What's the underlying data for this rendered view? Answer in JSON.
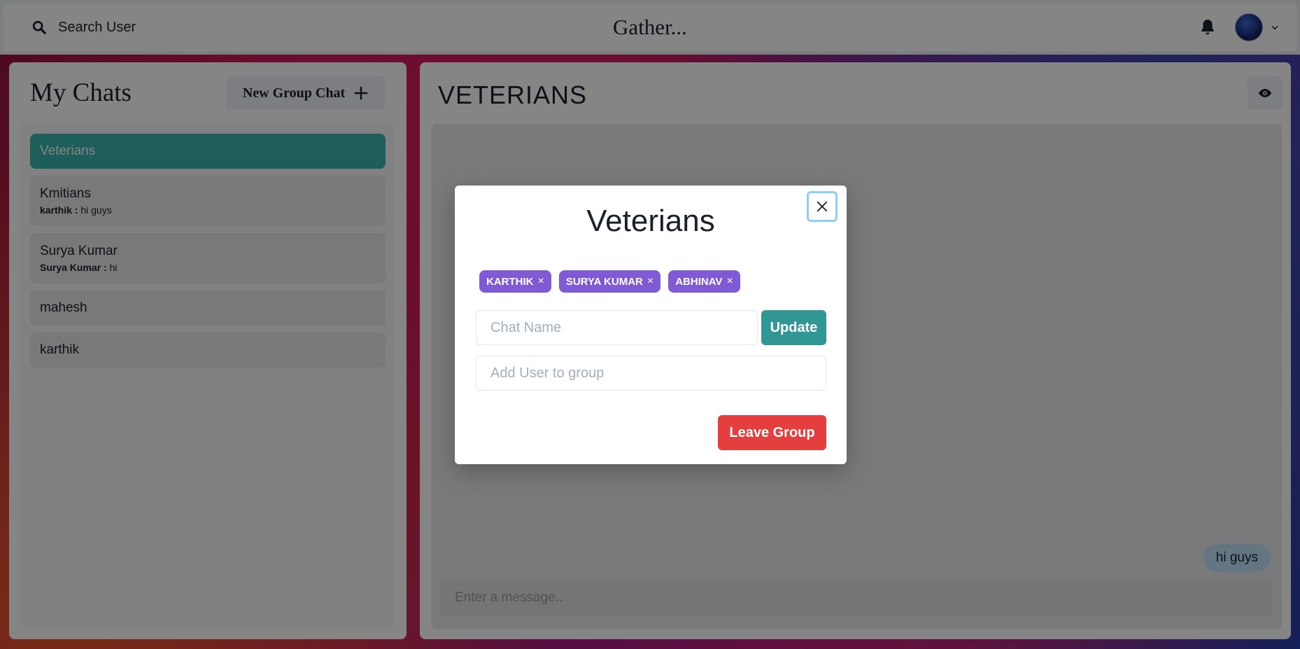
{
  "header": {
    "search_label": "Search User",
    "brand": "Gather...",
    "icons": [
      "search-icon",
      "bell-icon",
      "avatar",
      "chevron-down-icon"
    ]
  },
  "sidebar": {
    "title": "My Chats",
    "new_group_label": "New Group Chat",
    "chats": [
      {
        "name": "Veterians",
        "active": true
      },
      {
        "name": "Kmitians",
        "latest_sender": "karthik :",
        "latest_message": "hi guys"
      },
      {
        "name": "Surya Kumar",
        "latest_sender": "Surya Kumar :",
        "latest_message": "hi"
      },
      {
        "name": "mahesh"
      },
      {
        "name": "karthik"
      }
    ]
  },
  "chat": {
    "title": "VETERIANS",
    "messages": [
      {
        "text": "hi guys",
        "own": true
      }
    ],
    "input_placeholder": "Enter a message.."
  },
  "modal": {
    "title": "Veterians",
    "members": [
      "KARTHIK",
      "SURYA KUMAR",
      "ABHINAV"
    ],
    "remove_symbol": "×",
    "chat_name_placeholder": "Chat Name",
    "update_label": "Update",
    "add_user_placeholder": "Add User to group",
    "leave_label": "Leave Group"
  },
  "colors": {
    "active_chat": "#38b2ac",
    "badge": "#805ad5",
    "update_button": "#319795",
    "leave_button": "#e53e3e",
    "message_bubble": "#bee3f8"
  }
}
